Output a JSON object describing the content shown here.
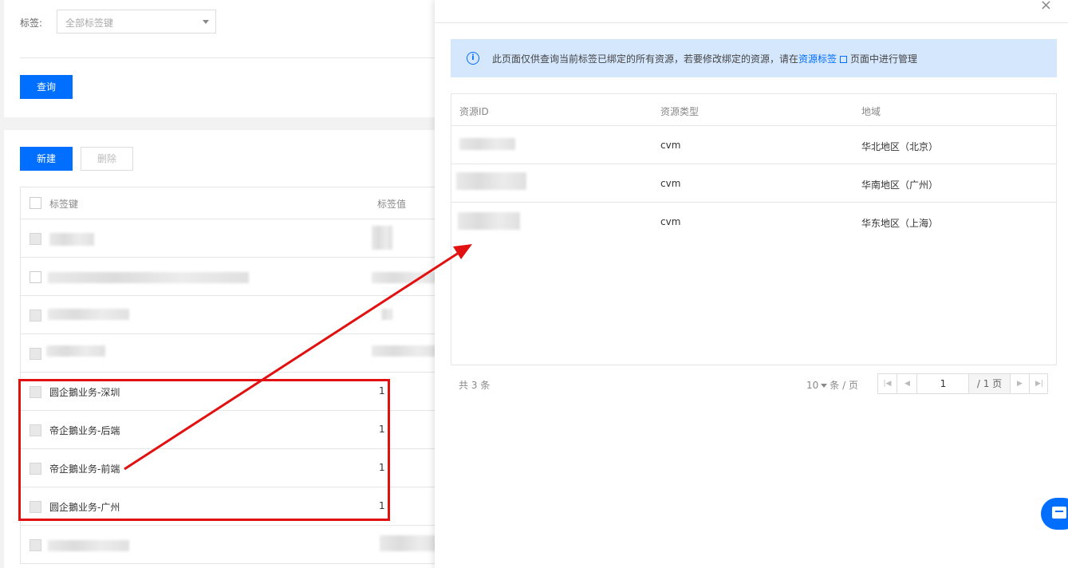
{
  "filter": {
    "label": "标签:",
    "placeholder": "全部标签键",
    "query_button": "查询"
  },
  "list": {
    "new_button": "新建",
    "delete_button": "删除",
    "columns": {
      "key": "标签键",
      "value": "标签值"
    },
    "rows": [
      {
        "key": "",
        "value": ""
      },
      {
        "key": "",
        "value": ""
      },
      {
        "key": "",
        "value": ""
      },
      {
        "key": "",
        "value": ""
      },
      {
        "key": "圆企鵝业务-深圳",
        "value": "1"
      },
      {
        "key": "帝企鵝业务-后端",
        "value": "1"
      },
      {
        "key": "帝企鵝业务-前端",
        "value": "1"
      },
      {
        "key": "圆企鵝业务-广州",
        "value": "1"
      },
      {
        "key": "",
        "value": ""
      }
    ]
  },
  "drawer": {
    "info": {
      "text_before": "此页面仅供查询当前标签已绑定的所有资源，若要修改绑定的资源，请在",
      "link": "资源标签",
      "text_after": "页面中进行管理"
    },
    "columns": {
      "id": "资源ID",
      "type": "资源类型",
      "region": "地域"
    },
    "rows": [
      {
        "id": "",
        "type": "cvm",
        "region": "华北地区（北京）"
      },
      {
        "id": "",
        "type": "cvm",
        "region": "华南地区（广州）"
      },
      {
        "id": "",
        "type": "cvm",
        "region": "华东地区（上海）"
      }
    ],
    "pager": {
      "total": "共 3 条",
      "page_size": "10",
      "page_unit": "条 / 页",
      "current_page": "1",
      "total_pages": "/ 1 页"
    }
  },
  "colors": {
    "accent": "#006eff",
    "highlight": "#e21111",
    "info_bg": "#d5e7fd"
  }
}
